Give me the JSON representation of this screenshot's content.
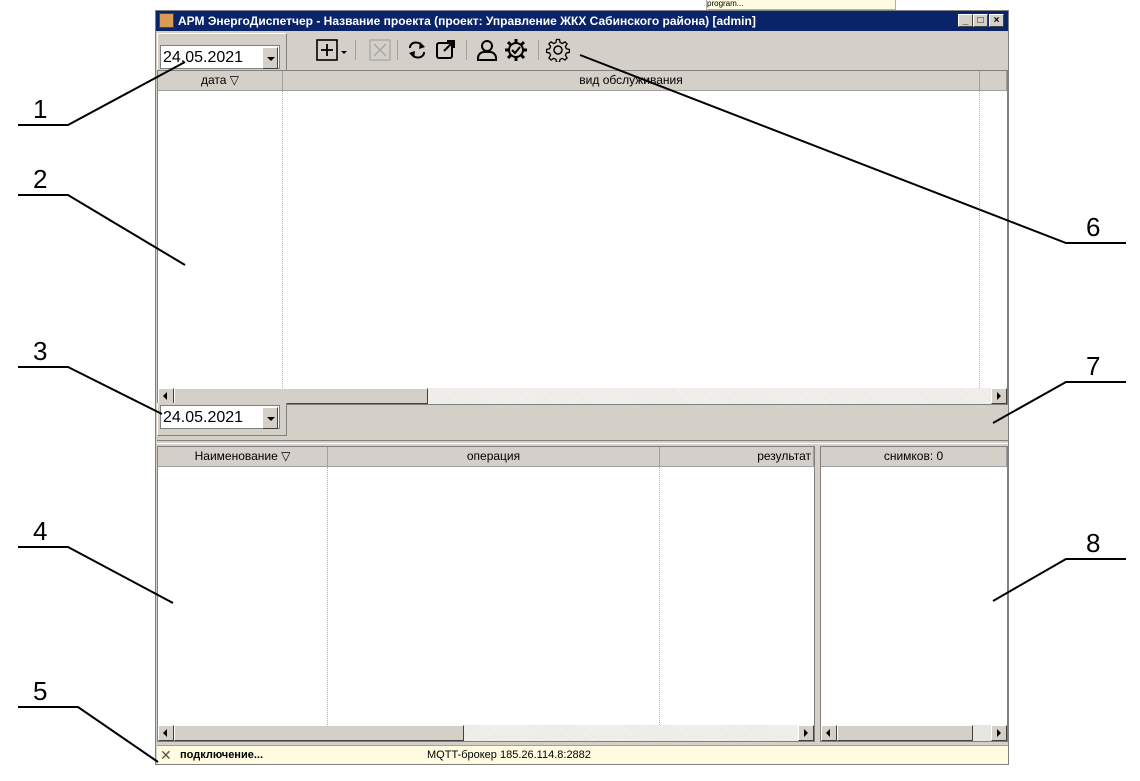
{
  "window": {
    "title": "АРМ ЭнергоДиспетчер - Название проекта (проект: Управление ЖКХ Сабинского района) [admin]",
    "bg_fragment": "program..."
  },
  "top_panel": {
    "date": "24.05.2021",
    "toolbar": [
      {
        "name": "add-icon"
      },
      {
        "name": "add-dropdown-icon"
      },
      {
        "name": "delete-icon"
      },
      {
        "name": "refresh-icon"
      },
      {
        "name": "open-external-icon"
      },
      {
        "name": "user-icon"
      },
      {
        "name": "settings-check-icon"
      },
      {
        "name": "gear-icon"
      }
    ],
    "columns": [
      {
        "label": "дата ▽"
      },
      {
        "label": "вид обслуживания"
      }
    ]
  },
  "bottom_panel": {
    "date": "24.05.2021",
    "columns": [
      {
        "label": "Наименование ▽"
      },
      {
        "label": "операция"
      },
      {
        "label": "результат"
      }
    ],
    "snapshots": "снимков: 0"
  },
  "status": {
    "connection": "подключение...",
    "broker": "MQTT-брокер 185.26.114.8:2882"
  },
  "callouts": [
    "1",
    "2",
    "3",
    "4",
    "5",
    "6",
    "7",
    "8"
  ],
  "colors": {
    "title_bg": "#0a246a",
    "window_bg": "#d4d0c8",
    "status_bg": "#fffbe0"
  }
}
